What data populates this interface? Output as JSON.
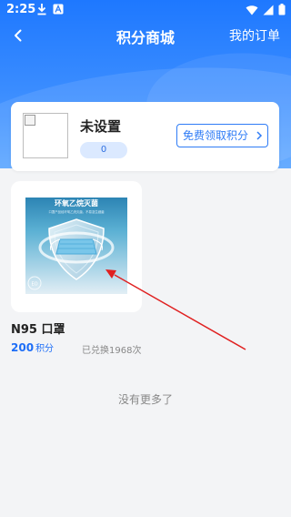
{
  "status_bar": {
    "time": "2:25"
  },
  "header": {
    "title": "积分商城",
    "my_orders": "我的订单"
  },
  "user": {
    "name": "未设置",
    "points": "0",
    "free_points_button": "免费领取积分"
  },
  "product": {
    "name": "N95 口罩",
    "price": "200",
    "price_unit": "积分",
    "redeemed": "已兑换1968次",
    "image_text": "环氧乙烷灭菌",
    "image_subtitle": "口罩产品经环氧乙烷灭菌，不易滋生细菌",
    "image_badge": "EO"
  },
  "footer": {
    "no_more": "没有更多了"
  },
  "colors": {
    "brand_blue": "#1e78ff",
    "annotation_red": "#e02020"
  }
}
